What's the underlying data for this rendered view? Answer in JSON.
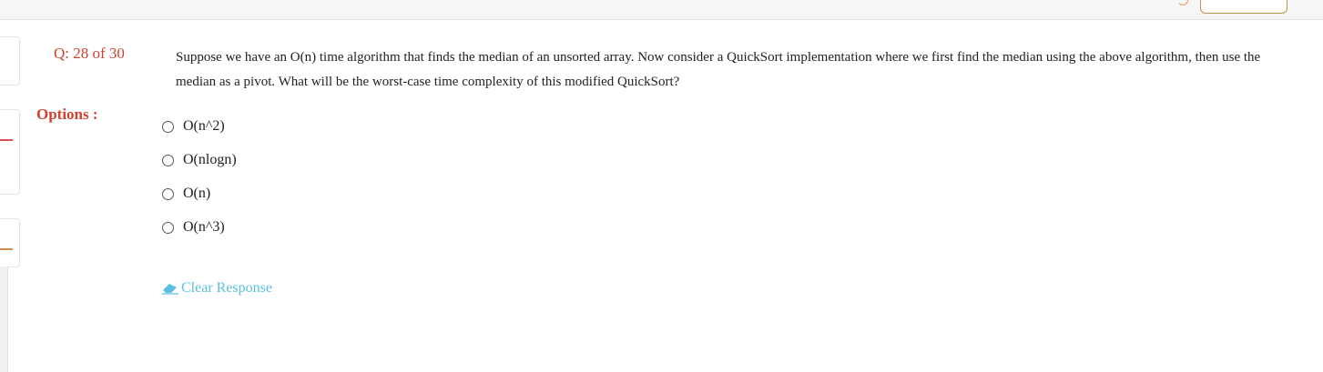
{
  "question": {
    "counter": "Q: 28 of 30",
    "text": "Suppose we have an O(n) time algorithm that finds the median of an unsorted array. Now consider a QuickSort implementation where we first find the median using the above algorithm, then use the median as a pivot. What will be the worst-case time complexity of this modified QuickSort?"
  },
  "options": {
    "label": "Options :",
    "items": [
      {
        "text": "O(n^2)",
        "selected": false
      },
      {
        "text": "O(nlogn)",
        "selected": false
      },
      {
        "text": "O(n)",
        "selected": false
      },
      {
        "text": "O(n^3)",
        "selected": false
      }
    ]
  },
  "clear_response": {
    "label": "Clear Response",
    "icon": "eraser-icon"
  },
  "colors": {
    "accent_red": "#d0402f",
    "link_blue": "#5bc0de",
    "border_gold": "#c8904a"
  }
}
